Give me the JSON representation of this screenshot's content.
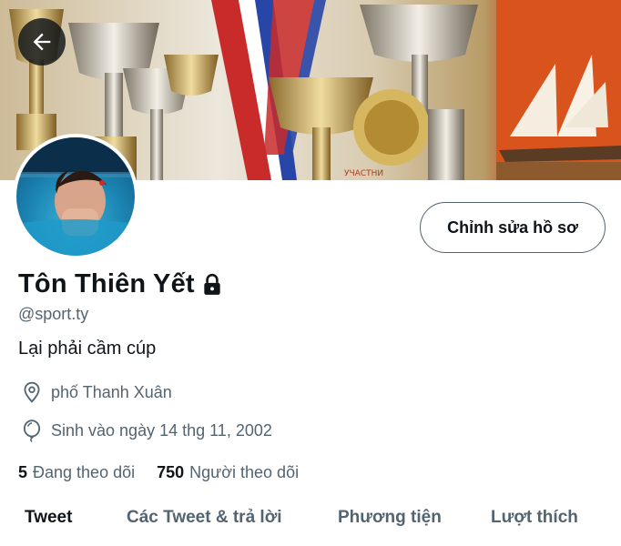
{
  "profile": {
    "name": "Tôn Thiên Yết",
    "handle": "@sport.ty",
    "bio": "Lại phải cầm cúp",
    "location": "phố Thanh Xuân",
    "birthday": "Sinh vào ngày 14 thg 11, 2002",
    "following_count": "5",
    "following_label": "Đang theo dõi",
    "followers_count": "750",
    "followers_label": "Người theo dõi",
    "protected": true
  },
  "actions": {
    "edit_profile_label": "Chỉnh sửa hồ sơ"
  },
  "banner": {
    "text": "УЧАСТНИ"
  },
  "tabs": [
    {
      "label": "Tweet",
      "active": true
    },
    {
      "label": "Các Tweet & trả lời",
      "active": false
    },
    {
      "label": "Phương tiện",
      "active": false
    },
    {
      "label": "Lượt thích",
      "active": false
    }
  ],
  "icons": {
    "back": "arrow-left-icon",
    "lock": "lock-icon",
    "location": "location-pin-icon",
    "birthday": "balloon-icon"
  },
  "colors": {
    "primary_text": "#0f1419",
    "secondary_text": "#536471"
  }
}
